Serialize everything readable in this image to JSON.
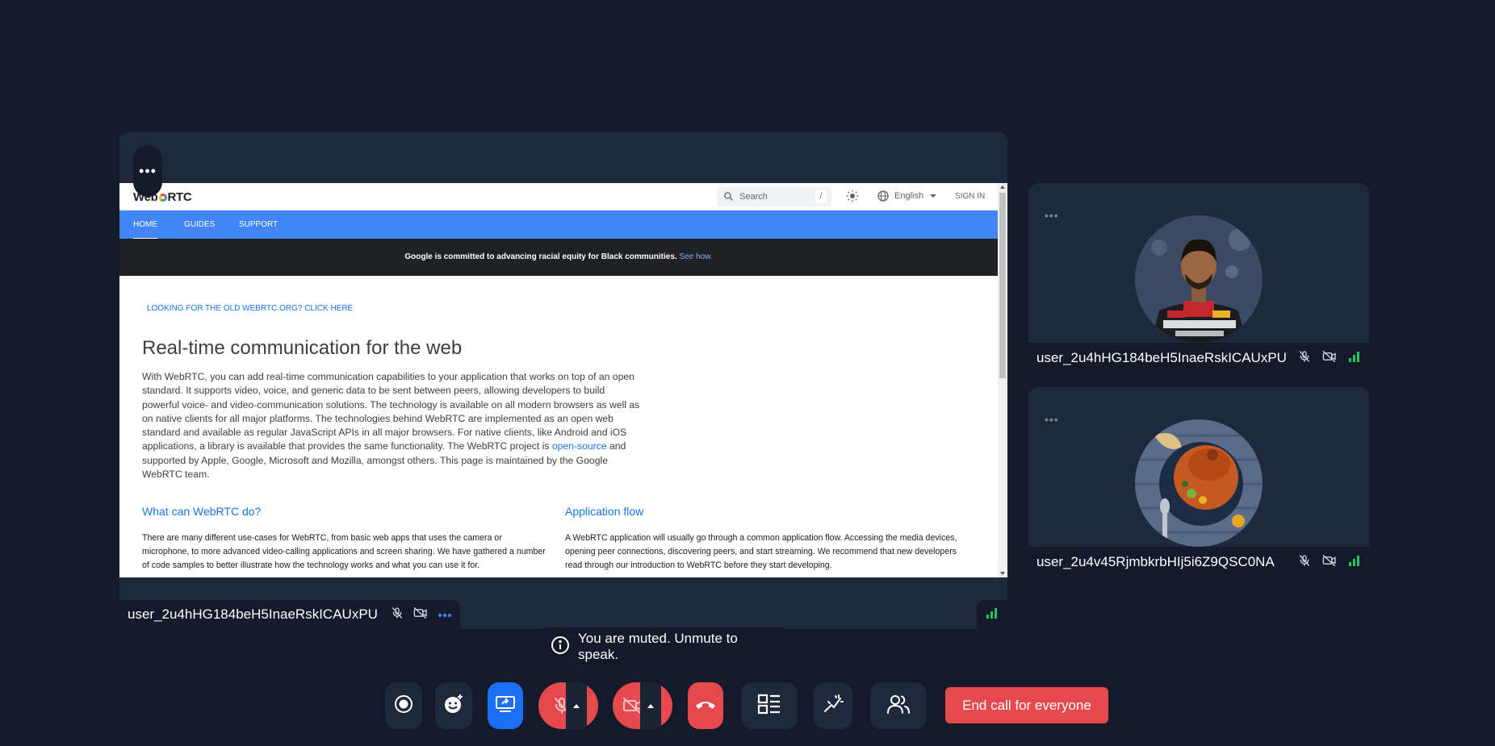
{
  "main_tile": {
    "menu_glyph": "•••",
    "participant_name": "user_2u4hHG184beH5InaeRskICAUxPU",
    "icons": [
      "mic-off-icon",
      "camera-off-icon",
      "more-dots-icon",
      "signal-icon"
    ]
  },
  "shared_screen": {
    "logo_left": "Web",
    "logo_right": "RTC",
    "search_placeholder": "Search",
    "search_shortcut": "/",
    "language": "English",
    "sign_in": "SIGN IN",
    "nav_tabs": [
      "HOME",
      "GUIDES",
      "SUPPORT"
    ],
    "banner_text": "Google is committed to advancing racial equity for Black communities.",
    "banner_link": "See how.",
    "old_site_link": "LOOKING FOR THE OLD WEBRTC.ORG? CLICK HERE",
    "heading": "Real-time communication for the web",
    "intro_before_link": "With WebRTC, you can add real-time communication capabilities to your application that works on top of an open standard. It supports video, voice, and generic data to be sent between peers, allowing developers to build powerful voice- and video-communication solutions. The technology is available on all modern browsers as well as on native clients for all major platforms. The technologies behind WebRTC are implemented as an open web standard and available as regular JavaScript APIs in all major browsers. For native clients, like Android and iOS applications, a library is available that provides the same functionality. The WebRTC project is ",
    "intro_link": "open-source",
    "intro_after_link": " and supported by Apple, Google, Microsoft and Mozilla, amongst others. This page is maintained by the Google WebRTC team.",
    "section_a_title": "What can WebRTC do?",
    "section_a_text": "There are many different use-cases for WebRTC, from basic web apps that uses the camera or microphone, to more advanced video-calling applications and screen sharing. We have gathered a number of code samples to better illustrate how the technology works and what you can use it for.",
    "section_b_title": "Application flow",
    "section_b_text": "A WebRTC application will usually go through a common application flow. Accessing the media devices, opening peer connections, discovering peers, and start streaming. We recommend that new developers read through our introduction to WebRTC before they start developing."
  },
  "participants": [
    {
      "name": "user_2u4hHG184beH5InaeRskICAUxPU",
      "avatar": "person-photo-avatar",
      "menu_glyph": "•••"
    },
    {
      "name": "user_2u4v45RjmbkrbHIj5i6Z9QSC0NA",
      "avatar": "food-photo-avatar",
      "menu_glyph": "•••"
    }
  ],
  "toast": {
    "text": "You are muted. Unmute to speak."
  },
  "controls": {
    "end_call_label": "End call for everyone"
  },
  "colors": {
    "background": "#141a2a",
    "tile": "#1e2a3c",
    "danger": "#e5484d",
    "accent": "#1a6ff5",
    "signal": "#22c55e"
  }
}
